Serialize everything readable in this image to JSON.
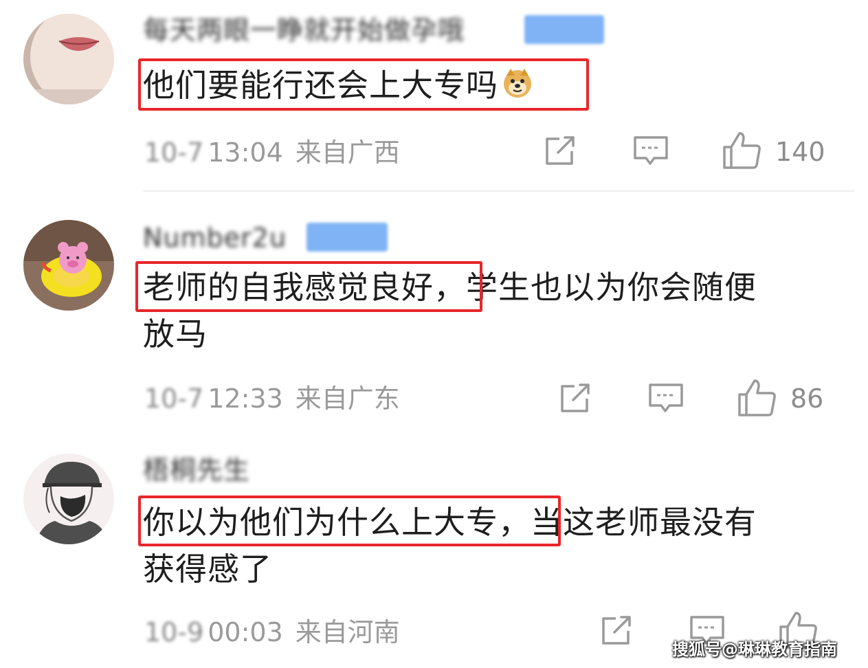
{
  "comments": [
    {
      "username": "每天两眼一睁就开始做孕哦",
      "text_line1_highlight": "他们要能行还会上大专吗",
      "emoji": "doge-emoji",
      "date": "10-7",
      "time": "13:04",
      "location": "来自广西",
      "likes": "140"
    },
    {
      "username": "Number2u",
      "text_line1_highlight": "老师的自我感觉良好，",
      "text_line1_rest": "学生也以为你会随便",
      "text_line2": "放马",
      "date": "10-7",
      "time": "12:33",
      "location": "来自广东",
      "likes": "86"
    },
    {
      "username": "梧桐先生",
      "text_line1_highlight": "你以为他们为什么上大专，",
      "text_line1_rest": "当这老师最没有",
      "text_line2": "获得感了",
      "date": "10-9",
      "time": "00:03",
      "location": "来自河南",
      "likes": ""
    }
  ],
  "icons": {
    "share": "share-icon",
    "reply": "comment-icon",
    "like": "thumbs-up-icon"
  },
  "colors": {
    "highlight_border": "#e8262a",
    "badge": "#7fb3f5",
    "meta_text": "#9a9a9a"
  },
  "watermark": "搜狐号@琳琳教育指南"
}
